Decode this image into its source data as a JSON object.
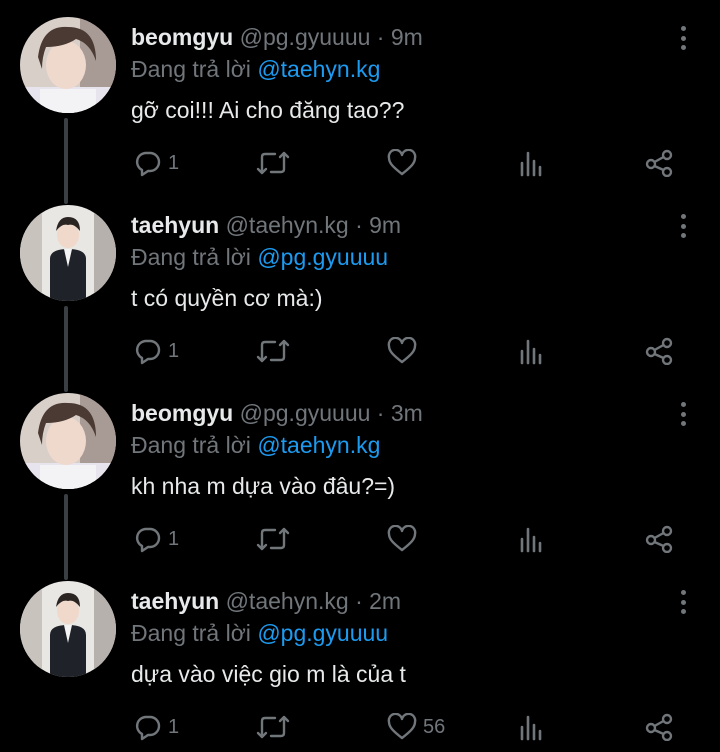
{
  "tweets": [
    {
      "display_name": "beomgyu",
      "handle": "@pg.gyuuuu",
      "time": "9m",
      "reply_prefix": "Đang trả lời",
      "reply_to": "@taehyn.kg",
      "text": "gỡ coi!!! Ai cho đăng tao??",
      "reply_count": "1",
      "like_count": "",
      "avatar": "beomgyu-avatar"
    },
    {
      "display_name": "taehyun",
      "handle": "@taehyn.kg",
      "time": "9m",
      "reply_prefix": "Đang trả lời",
      "reply_to": "@pg.gyuuuu",
      "text": "t có quyền cơ mà:)",
      "reply_count": "1",
      "like_count": "",
      "avatar": "taehyun-avatar"
    },
    {
      "display_name": "beomgyu",
      "handle": "@pg.gyuuuu",
      "time": "3m",
      "reply_prefix": "Đang trả lời",
      "reply_to": "@taehyn.kg",
      "text": "kh nha m dựa vào đâu?=)",
      "reply_count": "1",
      "like_count": "",
      "avatar": "beomgyu-avatar"
    },
    {
      "display_name": "taehyun",
      "handle": "@taehyn.kg",
      "time": "2m",
      "reply_prefix": "Đang trả lời",
      "reply_to": "@pg.gyuuuu",
      "text": "dựa vào việc gio m là của t",
      "reply_count": "1",
      "like_count": "56",
      "avatar": "taehyun-avatar"
    }
  ],
  "icons": {
    "reply": "reply-icon",
    "retweet": "retweet-icon",
    "like": "heart-icon",
    "views": "analytics-icon",
    "share": "share-icon",
    "more": "more-icon"
  },
  "colors": {
    "background": "#000000",
    "text": "#e7e9ea",
    "muted": "#71767b",
    "mention": "#1d9bf0",
    "thread_line": "#3a3f44"
  }
}
